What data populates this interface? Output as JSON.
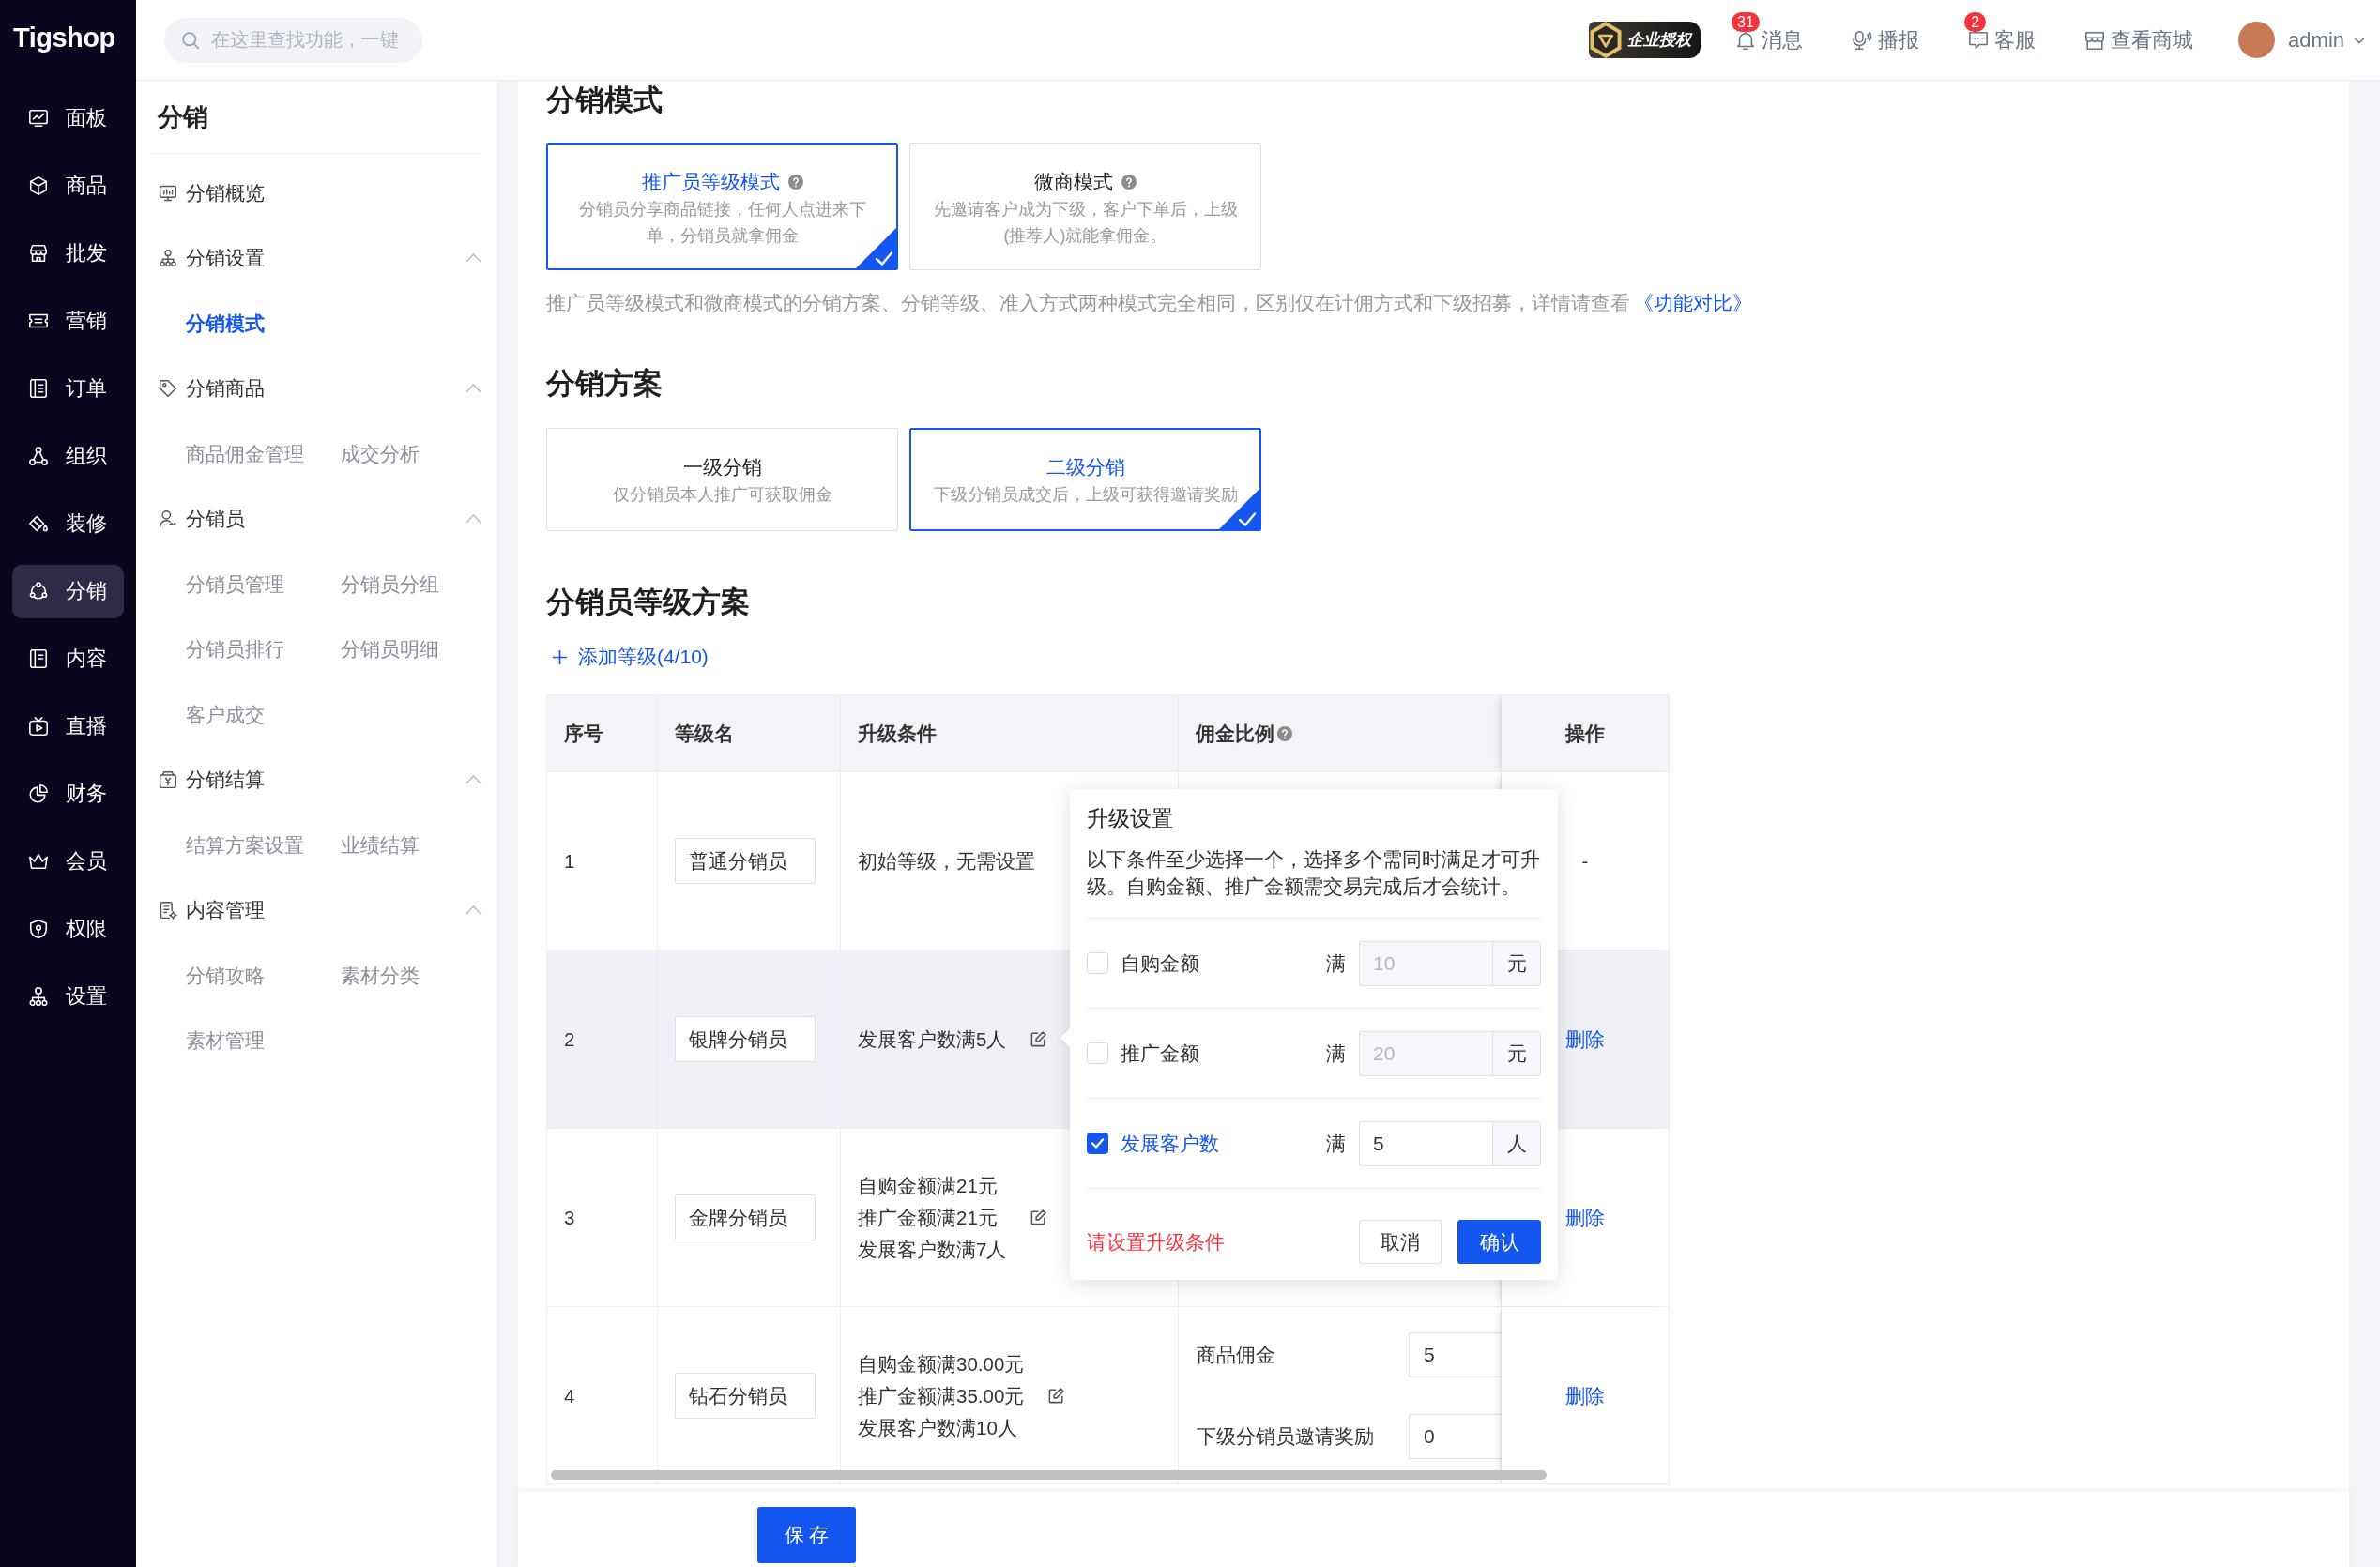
{
  "app": {
    "logo": "Tigshop",
    "search": {
      "placeholder": "在这里查找功能，一键"
    }
  },
  "main_nav": [
    {
      "label": "面板",
      "selected": false
    },
    {
      "label": "商品",
      "selected": false
    },
    {
      "label": "批发",
      "selected": false
    },
    {
      "label": "营销",
      "selected": false
    },
    {
      "label": "订单",
      "selected": false
    },
    {
      "label": "组织",
      "selected": false
    },
    {
      "label": "装修",
      "selected": false
    },
    {
      "label": "分销",
      "selected": true
    },
    {
      "label": "内容",
      "selected": false
    },
    {
      "label": "直播",
      "selected": false
    },
    {
      "label": "财务",
      "selected": false
    },
    {
      "label": "会员",
      "selected": false
    },
    {
      "label": "权限",
      "selected": false
    },
    {
      "label": "设置",
      "selected": false
    }
  ],
  "top_bar": {
    "license_badge": "企业授权",
    "actions": [
      {
        "label": "消息",
        "badge": "31"
      },
      {
        "label": "播报"
      },
      {
        "label": "客服",
        "badge": "2"
      },
      {
        "label": "查看商城"
      }
    ],
    "user": {
      "name": "admin"
    }
  },
  "sub_nav": {
    "title": "分销",
    "overview": {
      "label": "分销概览",
      "selected": false
    },
    "groups": [
      {
        "label": "分销设置",
        "expanded": true,
        "children": [
          {
            "label": "分销模式",
            "selected": true
          }
        ]
      },
      {
        "label": "分销商品",
        "expanded": true,
        "children": [
          {
            "label": "商品佣金管理",
            "selected": false
          },
          {
            "label": "成交分析",
            "selected": false
          }
        ]
      },
      {
        "label": "分销员",
        "expanded": true,
        "children": [
          {
            "label": "分销员管理",
            "selected": false
          },
          {
            "label": "分销员分组",
            "selected": false
          },
          {
            "label": "分销员排行",
            "selected": false
          },
          {
            "label": "分销员明细",
            "selected": false
          },
          {
            "label": "客户成交",
            "selected": false
          }
        ]
      },
      {
        "label": "分销结算",
        "expanded": true,
        "children": [
          {
            "label": "结算方案设置",
            "selected": false
          },
          {
            "label": "业绩结算",
            "selected": false
          }
        ]
      },
      {
        "label": "内容管理",
        "expanded": true,
        "children": [
          {
            "label": "分销攻略",
            "selected": false
          },
          {
            "label": "素材分类",
            "selected": false
          },
          {
            "label": "素材管理",
            "selected": false
          }
        ]
      }
    ]
  },
  "mode": {
    "title": "分销模式",
    "options": [
      {
        "title": "推广员等级模式",
        "help": true,
        "description": "分销员分享商品链接，任何人点进来下单，分销员就拿佣金",
        "selected": true
      },
      {
        "title": "微商模式",
        "help": true,
        "description": "先邀请客户成为下级，客户下单后，上级(推荐人)就能拿佣金。",
        "selected": false
      }
    ],
    "note": "推广员等级模式和微商模式的分销方案、分销等级、准入方式两种模式完全相同，区别仅在计佣方式和下级招募，详情请查看",
    "note_link": "《功能对比》"
  },
  "plan": {
    "title": "分销方案",
    "options": [
      {
        "title": "一级分销",
        "help": false,
        "description": "仅分销员本人推广可获取佣金",
        "selected": false
      },
      {
        "title": "二级分销",
        "help": false,
        "description": "下级分销员成交后，上级可获得邀请奖励",
        "selected": true
      }
    ]
  },
  "levels": {
    "title": "分销员等级方案",
    "add_button": "添加等级(4/10)",
    "columns": [
      {
        "label": "序号",
        "help": false
      },
      {
        "label": "等级名",
        "help": false
      },
      {
        "label": "升级条件",
        "help": false
      },
      {
        "label": "佣金比例",
        "help": true
      },
      {
        "label": "操作",
        "help": false
      }
    ],
    "rows": [
      {
        "index": "1",
        "name": "普通分销员",
        "conditions": [
          "初始等级，无需设置"
        ],
        "editable": false,
        "action": {
          "kind": "text",
          "label": "-"
        },
        "highlighted": false
      },
      {
        "index": "2",
        "name": "银牌分销员",
        "conditions": [
          "发展客户数满5人"
        ],
        "editable": true,
        "action": {
          "kind": "link",
          "label": "删除"
        },
        "highlighted": true
      },
      {
        "index": "3",
        "name": "金牌分销员",
        "conditions": [
          "自购金额满21元",
          "推广金额满21元",
          "发展客户数满7人"
        ],
        "editable": true,
        "action": {
          "kind": "link",
          "label": "删除"
        },
        "highlighted": false
      },
      {
        "index": "4",
        "name": "钻石分销员",
        "conditions": [
          "自购金额满30.00元",
          "推广金额满35.00元",
          "发展客户数满10人"
        ],
        "editable": true,
        "commission": [
          {
            "label": "商品佣金",
            "value": "5"
          },
          {
            "label": "下级分销员邀请奖励",
            "value": "0"
          }
        ],
        "action": {
          "kind": "link",
          "label": "删除"
        },
        "highlighted": false
      }
    ]
  },
  "upgrade_popover": {
    "title": "升级设置",
    "description": "以下条件至少选择一个，选择多个需同时满足才可升级。自购金额、推广金额需交易完成后才会统计。",
    "conditions": [
      {
        "label": "自购金额",
        "checked": false,
        "prefix": "满",
        "value": "10",
        "unit": "元"
      },
      {
        "label": "推广金额",
        "checked": false,
        "prefix": "满",
        "value": "20",
        "unit": "元"
      },
      {
        "label": "发展客户数",
        "checked": true,
        "prefix": "满",
        "value": "5",
        "unit": "人"
      }
    ],
    "error": "请设置升级条件",
    "buttons": [
      {
        "label": "取消",
        "kind": "secondary"
      },
      {
        "label": "确认",
        "kind": "primary"
      }
    ]
  },
  "save_button": "保 存"
}
